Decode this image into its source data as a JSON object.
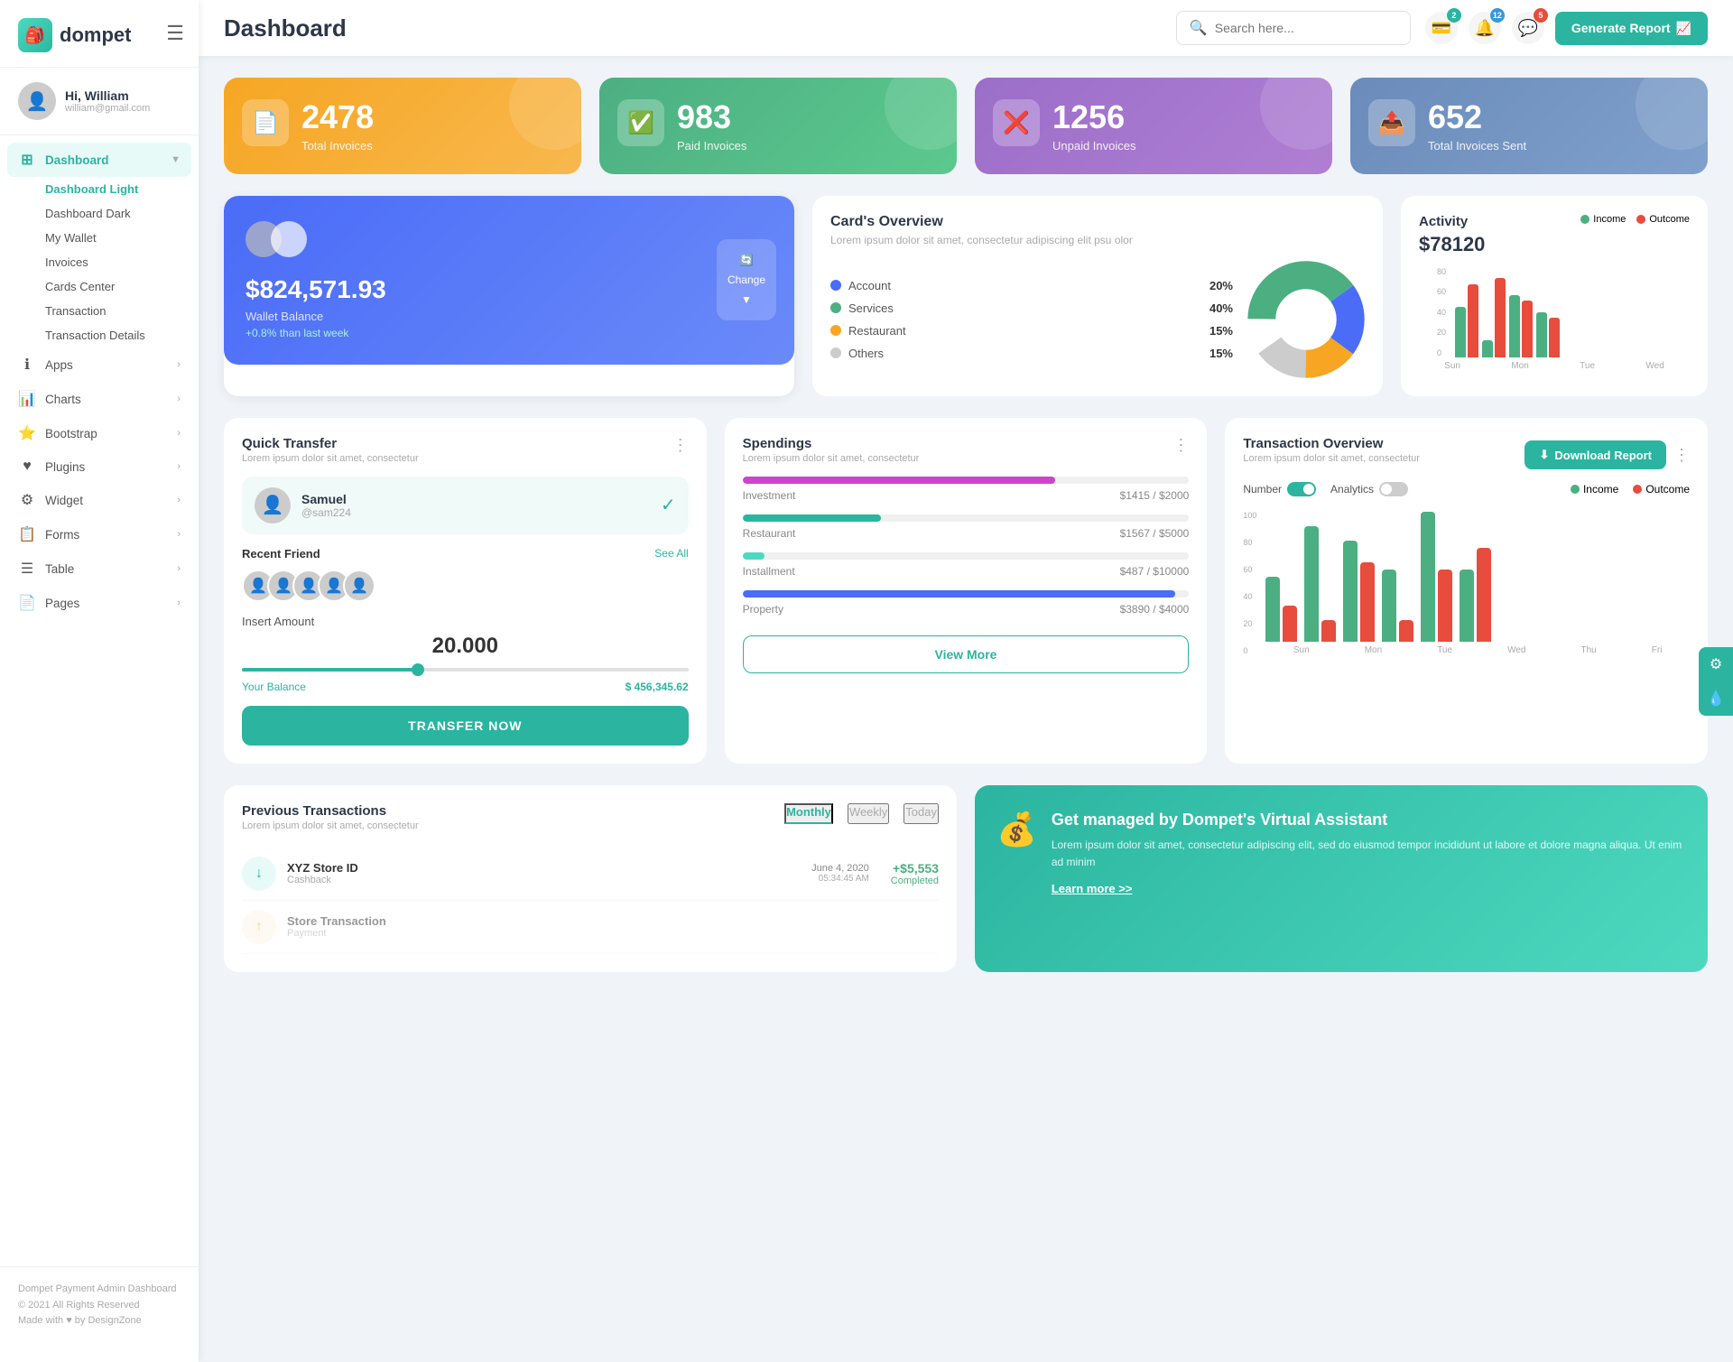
{
  "sidebar": {
    "logo_text": "dompet",
    "user": {
      "greeting": "Hi, William",
      "email": "william@gmail.com",
      "avatar_emoji": "👤"
    },
    "nav_main": [
      {
        "id": "dashboard",
        "label": "Dashboard",
        "icon": "⊞",
        "active": true,
        "has_arrow": true
      },
      {
        "id": "apps",
        "label": "Apps",
        "icon": "ℹ",
        "active": false,
        "has_arrow": true
      },
      {
        "id": "charts",
        "label": "Charts",
        "icon": "📊",
        "active": false,
        "has_arrow": true
      },
      {
        "id": "bootstrap",
        "label": "Bootstrap",
        "icon": "⭐",
        "active": false,
        "has_arrow": true
      },
      {
        "id": "plugins",
        "label": "Plugins",
        "icon": "♥",
        "active": false,
        "has_arrow": true
      },
      {
        "id": "widget",
        "label": "Widget",
        "icon": "⚙",
        "active": false,
        "has_arrow": true
      },
      {
        "id": "forms",
        "label": "Forms",
        "icon": "📋",
        "active": false,
        "has_arrow": true
      },
      {
        "id": "table",
        "label": "Table",
        "icon": "☰",
        "active": false,
        "has_arrow": true
      },
      {
        "id": "pages",
        "label": "Pages",
        "icon": "📄",
        "active": false,
        "has_arrow": true
      }
    ],
    "nav_sub": [
      {
        "label": "Dashboard Light",
        "active": true
      },
      {
        "label": "Dashboard Dark",
        "active": false
      },
      {
        "label": "My Wallet",
        "active": false
      },
      {
        "label": "Invoices",
        "active": false
      },
      {
        "label": "Cards Center",
        "active": false
      },
      {
        "label": "Transaction",
        "active": false
      },
      {
        "label": "Transaction Details",
        "active": false
      }
    ],
    "footer_text": "Dompet Payment Admin Dashboard",
    "footer_copy": "© 2021 All Rights Reserved",
    "footer_made": "Made with ♥ by DesignZone"
  },
  "topbar": {
    "title": "Dashboard",
    "search_placeholder": "Search here...",
    "badges": {
      "wallet": "2",
      "bell": "12",
      "chat": "5"
    },
    "generate_btn": "Generate Report"
  },
  "stats": [
    {
      "id": "total-invoices",
      "number": "2478",
      "label": "Total Invoices",
      "color": "orange",
      "icon": "📄"
    },
    {
      "id": "paid-invoices",
      "number": "983",
      "label": "Paid Invoices",
      "color": "green",
      "icon": "✅"
    },
    {
      "id": "unpaid-invoices",
      "number": "1256",
      "label": "Unpaid Invoices",
      "color": "purple",
      "icon": "❌"
    },
    {
      "id": "total-sent",
      "number": "652",
      "label": "Total Invoices Sent",
      "color": "slate",
      "icon": "📤"
    }
  ],
  "cards_overview": {
    "title": "Card's Overview",
    "subtitle": "Lorem ipsum dolor sit amet, consectetur adipiscing elit psu olor",
    "legend": [
      {
        "label": "Account",
        "pct": "20%",
        "color": "#4a6cf7"
      },
      {
        "label": "Services",
        "pct": "40%",
        "color": "#4caf82"
      },
      {
        "label": "Restaurant",
        "pct": "15%",
        "color": "#f6a623"
      },
      {
        "label": "Others",
        "pct": "15%",
        "color": "#ccc"
      }
    ],
    "pie_segments": [
      {
        "label": "Account",
        "pct": 20,
        "color": "#4a6cf7"
      },
      {
        "label": "Services",
        "pct": 40,
        "color": "#4caf82"
      },
      {
        "label": "Restaurant",
        "pct": 15,
        "color": "#f6a623"
      },
      {
        "label": "Others",
        "pct": 15,
        "color": "#ccc"
      }
    ]
  },
  "wallet": {
    "circles": [
      "#ccc",
      "#fff"
    ],
    "amount": "$824,571.93",
    "label": "Wallet Balance",
    "change": "+0.8% than last week",
    "change_btn": "Change"
  },
  "activity": {
    "title": "Activity",
    "amount": "$78120",
    "legend": [
      {
        "label": "Income",
        "color": "#4caf82"
      },
      {
        "label": "Outcome",
        "color": "#e74c3c"
      }
    ],
    "bars": [
      {
        "day": "Sun",
        "income": 45,
        "outcome": 65
      },
      {
        "day": "Mon",
        "income": 15,
        "outcome": 70
      },
      {
        "day": "Tue",
        "income": 55,
        "outcome": 50
      },
      {
        "day": "Wed",
        "income": 40,
        "outcome": 35
      }
    ]
  },
  "quick_transfer": {
    "title": "Quick Transfer",
    "subtitle": "Lorem ipsum dolor sit amet, consectetur",
    "user": {
      "name": "Samuel",
      "handle": "@sam224",
      "emoji": "👤"
    },
    "recent_label": "Recent Friend",
    "see_all": "See All",
    "friends": [
      "👤",
      "👤",
      "👤",
      "👤",
      "👤"
    ],
    "insert_label": "Insert Amount",
    "amount": "20.000",
    "balance_label": "Your Balance",
    "balance_value": "$ 456,345.62",
    "transfer_btn": "TRANSFER NOW"
  },
  "spendings": {
    "title": "Spendings",
    "subtitle": "Lorem ipsum dolor sit amet, consectetur",
    "items": [
      {
        "label": "Investment",
        "amount": "$1415",
        "max": "$2000",
        "pct": 70,
        "color": "#cc44cc"
      },
      {
        "label": "Restaurant",
        "amount": "$1567",
        "max": "$5000",
        "pct": 31,
        "color": "#2bb5a0"
      },
      {
        "label": "Installment",
        "amount": "$487",
        "max": "$10000",
        "pct": 5,
        "color": "#4dd9c0"
      },
      {
        "label": "Property",
        "amount": "$3890",
        "max": "$4000",
        "pct": 97,
        "color": "#4a6cf7"
      }
    ],
    "view_more_btn": "View More"
  },
  "txn_overview": {
    "title": "Transaction Overview",
    "subtitle": "Lorem ipsum dolor sit amet, consectetur",
    "download_btn": "Download Report",
    "toggles": [
      {
        "label": "Number",
        "active": true
      },
      {
        "label": "Analytics",
        "active": false
      }
    ],
    "legend": [
      {
        "label": "Income",
        "color": "#4caf82"
      },
      {
        "label": "Outcome",
        "color": "#e74c3c"
      }
    ],
    "bars": [
      {
        "day": "Sun",
        "income": 45,
        "outcome": 25
      },
      {
        "day": "Mon",
        "income": 80,
        "outcome": 15
      },
      {
        "day": "Tue",
        "income": 70,
        "outcome": 55
      },
      {
        "day": "Wed",
        "income": 50,
        "outcome": 15
      },
      {
        "day": "Thu",
        "income": 90,
        "outcome": 50
      },
      {
        "day": "Fri",
        "income": 50,
        "outcome": 65
      }
    ],
    "y_labels": [
      "100",
      "80",
      "60",
      "40",
      "20",
      "0"
    ]
  },
  "prev_transactions": {
    "title": "Previous Transactions",
    "subtitle": "Lorem ipsum dolor sit amet, consectetur",
    "tabs": [
      "Monthly",
      "Weekly",
      "Today"
    ],
    "active_tab": 0,
    "items": [
      {
        "icon": "↓",
        "name": "XYZ Store ID",
        "type": "Cashback",
        "date": "June 4, 2020",
        "time": "05:34:45 AM",
        "amount": "+$5,553",
        "status": "Completed",
        "icon_color": "#2bb5a0"
      }
    ]
  },
  "virtual_assistant": {
    "title": "Get managed by Dompet's Virtual Assistant",
    "text": "Lorem ipsum dolor sit amet, consectetur adipiscing elit, sed do eiusmod tempor incididunt ut labore et dolore magna aliqua. Ut enim ad minim",
    "link": "Learn more >>"
  },
  "floating_btns": [
    {
      "id": "settings-float",
      "icon": "⚙"
    },
    {
      "id": "water-float",
      "icon": "💧"
    }
  ]
}
